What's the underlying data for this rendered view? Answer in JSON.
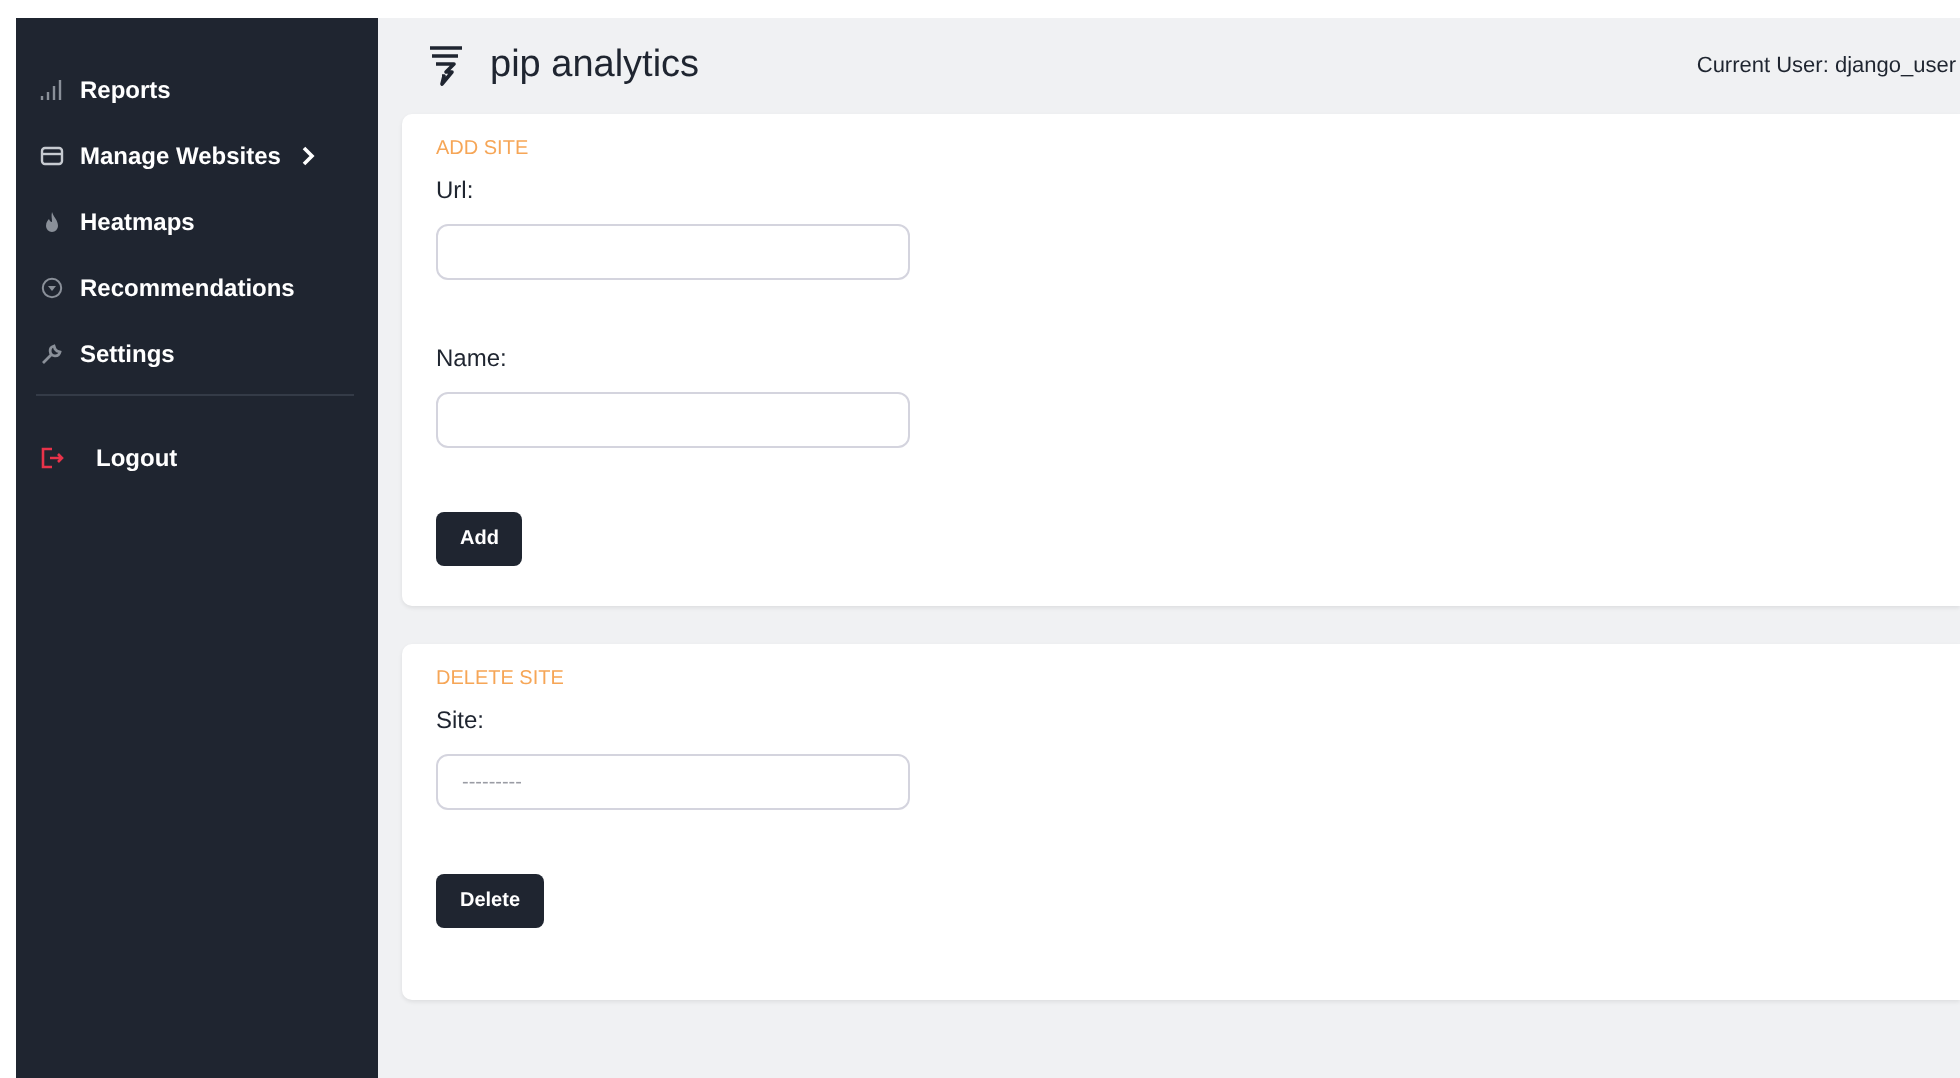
{
  "sidebar": {
    "items": [
      {
        "label": "Reports",
        "submenu": false
      },
      {
        "label": "Manage Websites",
        "submenu": true
      },
      {
        "label": "Heatmaps",
        "submenu": false
      },
      {
        "label": "Recommendations",
        "submenu": false
      },
      {
        "label": "Settings",
        "submenu": false
      }
    ],
    "bottom_items": [
      {
        "label": "Logout"
      }
    ]
  },
  "header": {
    "title": "pip analytics",
    "user": "Current User: django_user"
  },
  "cards": [
    {
      "heading": "ADD SITE",
      "fields": [
        {
          "label": "Url:",
          "kind": "text"
        },
        {
          "label": "Name:",
          "kind": "text"
        }
      ],
      "button": "Add"
    },
    {
      "heading": "DELETE SITE",
      "fields": [
        {
          "label": "Site:",
          "kind": "select",
          "value": "---------"
        }
      ],
      "button": "Delete"
    }
  ]
}
